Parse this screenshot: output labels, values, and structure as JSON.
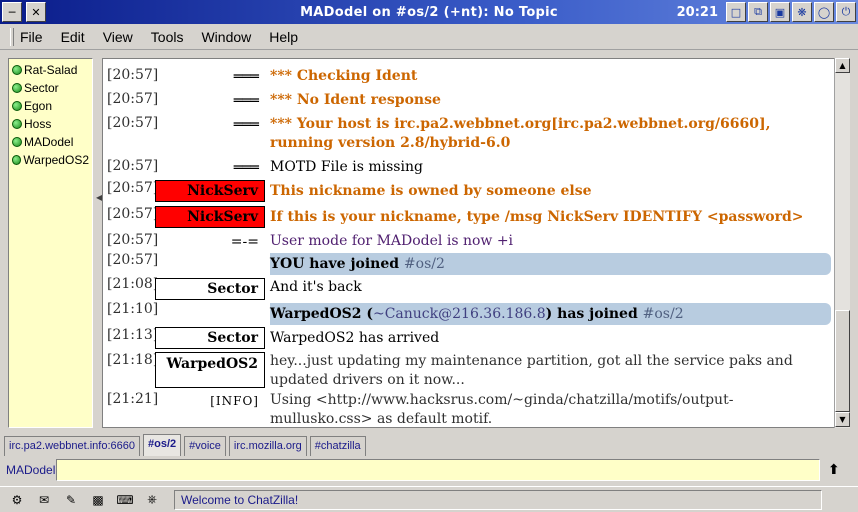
{
  "window": {
    "title": "MADodel on #os/2 (+nt): No Topic",
    "clock": "20:21"
  },
  "menu": [
    "File",
    "Edit",
    "View",
    "Tools",
    "Window",
    "Help"
  ],
  "userlist": [
    "Rat-Salad",
    "Sector",
    "Egon",
    "Hoss",
    "MADodel",
    "WarpedOS2"
  ],
  "messages": [
    {
      "ts": "[20:57]",
      "nick": "═══",
      "text": "*** Checking Ident"
    },
    {
      "ts": "[20:57]",
      "nick": "═══",
      "text": "*** No Ident response"
    },
    {
      "ts": "[20:57]",
      "nick": "═══",
      "text": "*** Your host is irc.pa2.webbnet.org[irc.pa2.webbnet.org/6660], running version 2.8/hybrid-6.0"
    },
    {
      "ts": "[20:57]",
      "nick": "═══",
      "text": "MOTD File is missing"
    },
    {
      "ts": "[20:57]",
      "nick": "NickServ",
      "text": "This nickname is owned by someone else"
    },
    {
      "ts": "[20:57]",
      "nick": "NickServ",
      "text": "If this is your nickname, type /msg NickServ IDENTIFY <password>"
    },
    {
      "ts": "[20:57]",
      "nick": "=-=",
      "text": "User mode for MADodel is now +i"
    },
    {
      "ts": "[20:57]",
      "text_a": "YOU have joined ",
      "chan": "#os/2"
    },
    {
      "ts": "[21:08]",
      "nick": "Sector",
      "text": "And it's back"
    },
    {
      "ts": "[21:10]",
      "text_a": "WarpedOS2 (",
      "host": "~Canuck@216.36.186.8",
      "text_b": ") has joined ",
      "chan": "#os/2"
    },
    {
      "ts": "[21:13]",
      "nick": "Sector",
      "text": "WarpedOS2 has arrived"
    },
    {
      "ts": "[21:18]",
      "nick": "WarpedOS2",
      "text": "hey...just updating my maintenance partition, got all the service paks and updated drivers on it now..."
    },
    {
      "ts": "[21:21]",
      "nick": "[INFO]",
      "text": "Using <http://www.hacksrus.com/~ginda/chatzilla/motifs/output-mullusko.css> as default motif."
    }
  ],
  "tabs": [
    "irc.pa2.webbnet.info:6660",
    "#os/2",
    "#voice",
    "irc.mozilla.org",
    "#chatzilla"
  ],
  "input": {
    "nick": "MADodel",
    "value": ""
  },
  "status": "Welcome to ChatZilla!",
  "colors": {
    "nickserv_bg": "#ff0000",
    "userlist_bg": "#ffffc8",
    "join_bg": "#b8cce0",
    "server_msg": "#cc6600"
  }
}
